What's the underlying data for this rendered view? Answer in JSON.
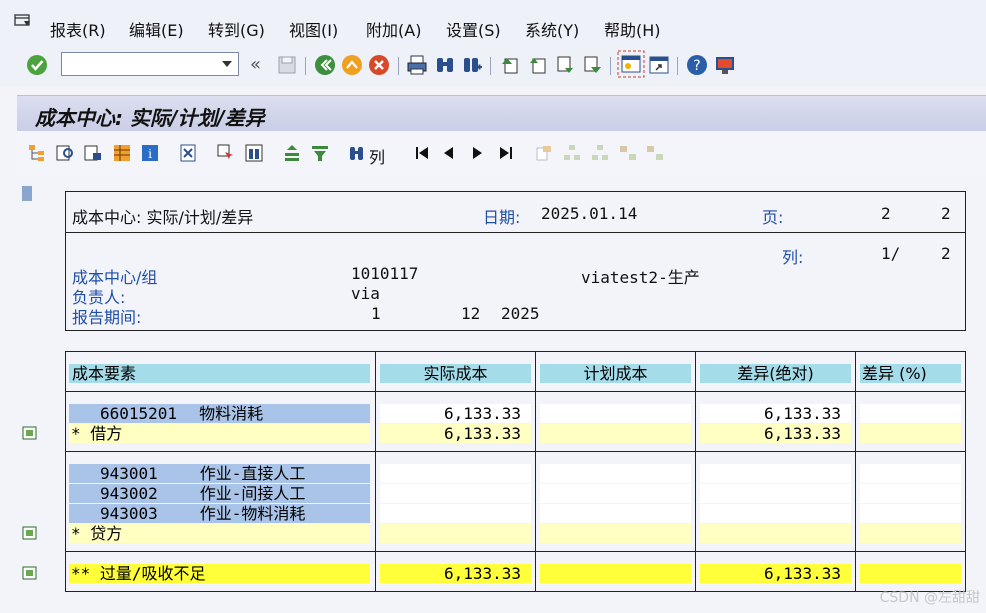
{
  "menu": [
    "报表(R)",
    "编辑(E)",
    "转到(G)",
    "视图(I)",
    "附加(A)",
    "设置(S)",
    "系统(Y)",
    "帮助(H)"
  ],
  "command_field": {
    "value": ""
  },
  "page_title": "成本中心: 实际/计划/差异",
  "alv_toolbar": {
    "columns_label": "列"
  },
  "header_box": {
    "title": "成本中心: 实际/计划/差异",
    "date_label": "日期:",
    "date_value": "2025.01.14",
    "page_label": "页:",
    "page_value": "2",
    "page_total": "2",
    "column_label": "列:",
    "column_value": "1/",
    "column_total": "2",
    "cost_center_label": "成本中心/组",
    "cost_center_value": "1010117",
    "cost_center_desc": "viatest2-生产",
    "responsible_label": "负责人:",
    "responsible_value": "via",
    "period_label": "报告期间:",
    "period_from": "1",
    "period_to": "12",
    "period_year": "2025"
  },
  "table": {
    "headers": [
      "成本要素",
      "实际成本",
      "计划成本",
      "差异(绝对)",
      "差异 (%)"
    ],
    "debit_rows": [
      {
        "element": "66015201",
        "name": "物料消耗",
        "actual": "6,133.33",
        "plan": "",
        "var_abs": "6,133.33",
        "var_pct": ""
      }
    ],
    "debit_total": {
      "label": "*  借方",
      "actual": "6,133.33",
      "plan": "",
      "var_abs": "6,133.33",
      "var_pct": ""
    },
    "credit_rows": [
      {
        "element": "943001",
        "name": "作业-直接人工",
        "actual": "",
        "plan": "",
        "var_abs": "",
        "var_pct": ""
      },
      {
        "element": "943002",
        "name": "作业-间接人工",
        "actual": "",
        "plan": "",
        "var_abs": "",
        "var_pct": ""
      },
      {
        "element": "943003",
        "name": "作业-物料消耗",
        "actual": "",
        "plan": "",
        "var_abs": "",
        "var_pct": ""
      }
    ],
    "credit_total": {
      "label": "*  贷方",
      "actual": "",
      "plan": "",
      "var_abs": "",
      "var_pct": ""
    },
    "grand_total": {
      "label": "** 过量/吸收不足",
      "actual": "6,133.33",
      "plan": "",
      "var_abs": "6,133.33",
      "var_pct": ""
    }
  },
  "watermark": "CSDN @左甜甜",
  "colors": {
    "header_cell": "#a4dcea",
    "key_cell": "#a9c4e8",
    "subtotal": "#ffffc2",
    "total": "#ffff3a",
    "label_text": "#1f4ea8"
  }
}
